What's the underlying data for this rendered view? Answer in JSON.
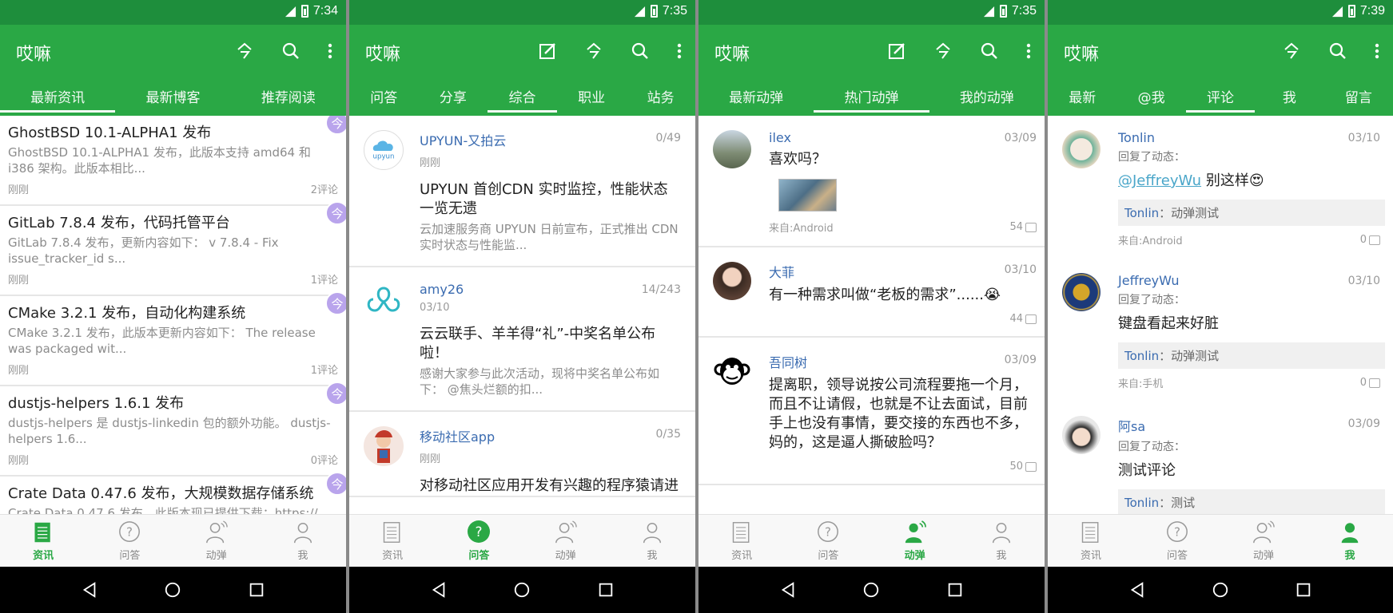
{
  "app_title": "哎嘛",
  "colors": {
    "primary": "#2aa845",
    "status": "#1e8e3c",
    "link": "#3a6bb0",
    "badge": "#b9a4ec"
  },
  "screens": [
    {
      "time": "7:34",
      "tabs": [
        "最新资讯",
        "最新博客",
        "推荐阅读"
      ],
      "active_tab": 0,
      "bottom_active": 0,
      "news": [
        {
          "title": "GhostBSD 10.1-ALPHA1 发布",
          "desc": "GhostBSD 10.1-ALPHA1 发布，此版本支持 amd64 和 i386 架构。此版本相比...",
          "time": "刚刚",
          "comments": "2评论"
        },
        {
          "title": "GitLab 7.8.4 发布，代码托管平台",
          "desc": "GitLab 7.8.4 发布，更新内容如下： v 7.8.4 - Fix issue_tracker_id s...",
          "time": "刚刚",
          "comments": "1评论"
        },
        {
          "title": "CMake 3.2.1 发布，自动化构建系统",
          "desc": "CMake 3.2.1 发布，此版本更新内容如下： The release was packaged wit...",
          "time": "刚刚",
          "comments": "1评论"
        },
        {
          "title": "dustjs-helpers 1.6.1 发布",
          "desc": "dustjs-helpers 是 dustjs-linkedin 包的额外功能。 dustjs-helpers 1.6...",
          "time": "刚刚",
          "comments": "0评论"
        },
        {
          "title": "Crate Data 0.47.6 发布，大规模数据存储系统",
          "desc": "Crate Data 0.47.6 发布，此版本现已提供下载：https://...",
          "time": "",
          "comments": ""
        }
      ],
      "badge": "今"
    },
    {
      "time": "7:35",
      "tabs": [
        "问答",
        "分享",
        "综合",
        "职业",
        "站务"
      ],
      "active_tab": 2,
      "bottom_active": 1,
      "posts": [
        {
          "name": "UPYUN-又拍云",
          "count": "0/49",
          "time": "刚刚",
          "title": "UPYUN 首创CDN 实时监控，性能状态一览无遗",
          "desc": "云加速服务商 UPYUN 日前宣布，正式推出 CDN 实时状态与性能监...",
          "avatar_text": "upyun"
        },
        {
          "name": "amy26",
          "count": "14/243",
          "time": "03/10",
          "title": "云云联手、羊羊得“礼”-中奖名单公布啦！",
          "desc": "感谢大家参与此次活动，现将中奖名单公布如下： @焦头烂额的扣...",
          "avatar_text": ""
        },
        {
          "name": "移动社区app",
          "count": "0/35",
          "time": "刚刚",
          "title": "对移动社区应用开发有兴趣的程序猿请进",
          "desc": "",
          "avatar_text": ""
        }
      ]
    },
    {
      "time": "7:35",
      "tabs": [
        "最新动弹",
        "热门动弹",
        "我的动弹"
      ],
      "active_tab": 1,
      "bottom_active": 2,
      "tweets": [
        {
          "name": "ilex",
          "date": "03/09",
          "body": "喜欢吗？",
          "source": "来自:Android",
          "count": "54",
          "has_image": true
        },
        {
          "name": "大菲",
          "date": "03/10",
          "body": "有一种需求叫做“老板的需求”......😭",
          "source": "",
          "count": "44",
          "has_image": false
        },
        {
          "name": "吾同树",
          "date": "03/09",
          "body": "提离职，领导说按公司流程要拖一个月，而且不让请假，也就是不让去面试，目前手上也没有事情，要交接的东西也不多，妈的，这是逼人撕破脸吗？",
          "source": "",
          "count": "50",
          "has_image": false
        }
      ]
    },
    {
      "time": "7:39",
      "tabs": [
        "最新",
        "@我",
        "评论",
        "我",
        "留言"
      ],
      "active_tab": 2,
      "bottom_active": 3,
      "comments": [
        {
          "name": "Tonlin",
          "date": "03/10",
          "reply": "回复了动态：",
          "mention": "@JeffreyWu",
          "body": " 别这样😍",
          "quote_name": "Tonlin",
          "quote_text": "：动弹测试",
          "source": "来自:Android",
          "count": "0"
        },
        {
          "name": "JeffreyWu",
          "date": "03/10",
          "reply": "回复了动态：",
          "mention": "",
          "body": "键盘看起来好脏",
          "quote_name": "Tonlin",
          "quote_text": "：动弹测试",
          "source": "来自:手机",
          "count": "0"
        },
        {
          "name": "阿sa",
          "date": "03/09",
          "reply": "回复了动态：",
          "mention": "",
          "body": "测试评论",
          "quote_name": "Tonlin",
          "quote_text": "：测试",
          "source": "",
          "count": ""
        }
      ]
    }
  ],
  "bottom_nav": [
    "资讯",
    "问答",
    "动弹",
    "我"
  ]
}
